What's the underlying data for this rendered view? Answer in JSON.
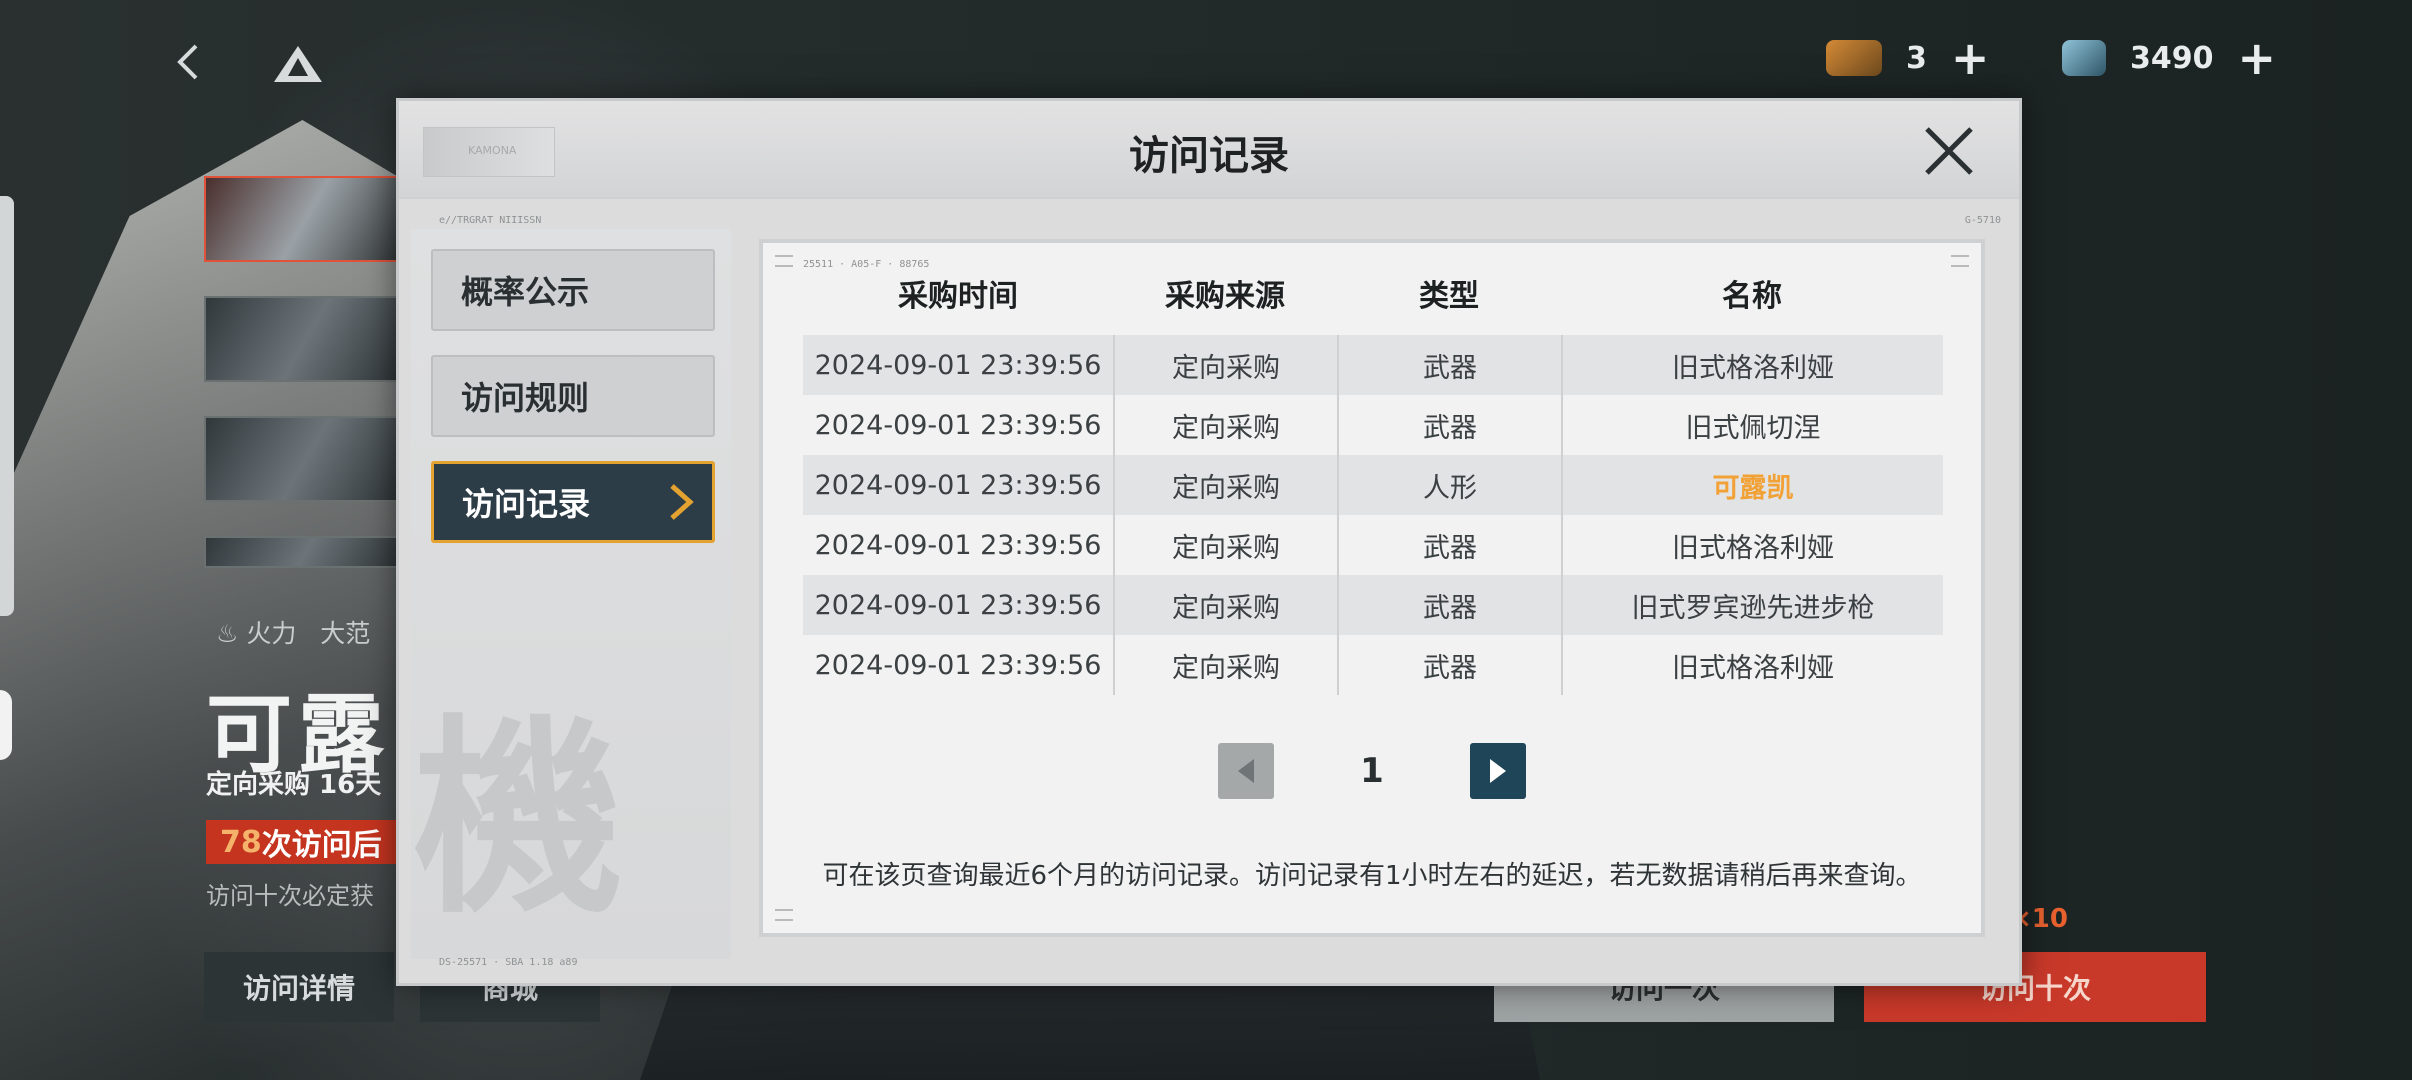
{
  "resources": {
    "currency_a": {
      "icon": "ticket-icon",
      "count": "3",
      "add": "+"
    },
    "currency_b": {
      "icon": "crystal-icon",
      "count": "3490",
      "add": "+"
    }
  },
  "background": {
    "element_tag": "火力",
    "range_tag": "大范",
    "character_name": "可露",
    "subtitle": "定向采购 16天",
    "promo_number": "78",
    "promo_text": "次访问后",
    "note": "访问十次必定获",
    "buttons": {
      "detail": "访问详情",
      "shop": "商城",
      "visit_once": "访问一次",
      "visit_ten": "访问十次"
    },
    "ten_tag": "×10"
  },
  "modal": {
    "title": "访问记录",
    "logo_text": "KAMONA",
    "header_code_left": "e//TRGRAT NIIISSN",
    "header_code_right": "G-5710",
    "stamp_code": "25511 · A05-F · 88765",
    "footer_code": "DS-25571 · SBA 1.18 a89",
    "menu": [
      {
        "label": "概率公示",
        "active": false
      },
      {
        "label": "访问规则",
        "active": false
      },
      {
        "label": "访问记录",
        "active": true
      }
    ],
    "watermark": "機",
    "table": {
      "headers": [
        "采购时间",
        "采购来源",
        "类型",
        "名称"
      ],
      "rows": [
        {
          "time": "2024-09-01 23:39:56",
          "source": "定向采购",
          "type": "武器",
          "name": "旧式格洛利娅",
          "highlight": false
        },
        {
          "time": "2024-09-01 23:39:56",
          "source": "定向采购",
          "type": "武器",
          "name": "旧式佩切涅",
          "highlight": false
        },
        {
          "time": "2024-09-01 23:39:56",
          "source": "定向采购",
          "type": "人形",
          "name": "可露凯",
          "highlight": true
        },
        {
          "time": "2024-09-01 23:39:56",
          "source": "定向采购",
          "type": "武器",
          "name": "旧式格洛利娅",
          "highlight": false
        },
        {
          "time": "2024-09-01 23:39:56",
          "source": "定向采购",
          "type": "武器",
          "name": "旧式罗宾逊先进步枪",
          "highlight": false
        },
        {
          "time": "2024-09-01 23:39:56",
          "source": "定向采购",
          "type": "武器",
          "name": "旧式格洛利娅",
          "highlight": false
        }
      ]
    },
    "pagination": {
      "page": "1"
    },
    "note": "可在该页查询最近6个月的访问记录。访问记录有1小时左右的延迟，若无数据请稍后再来查询。"
  },
  "colors": {
    "highlight": "#f1a135",
    "active_border": "#e4a230",
    "active_bg": "#2d3d47",
    "promo": "#c5341f"
  }
}
